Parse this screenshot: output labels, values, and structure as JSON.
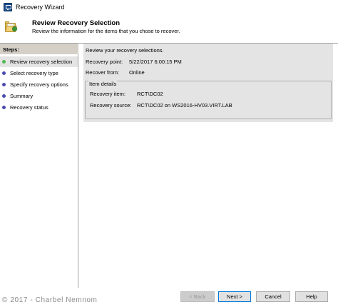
{
  "window": {
    "title": "Recovery Wizard"
  },
  "header": {
    "title": "Review Recovery Selection",
    "subtitle": "Review the information for the items that you chose to recover."
  },
  "steps": {
    "heading": "Steps:",
    "items": [
      {
        "label": "Review recovery selection",
        "active": true,
        "dot_color": "#4fb84f"
      },
      {
        "label": "Select recovery type",
        "active": false,
        "dot_color": "#4b4bb0"
      },
      {
        "label": "Specify recovery options",
        "active": false,
        "dot_color": "#4b4bb0"
      },
      {
        "label": "Summary",
        "active": false,
        "dot_color": "#4b4bb0"
      },
      {
        "label": "Recovery status",
        "active": false,
        "dot_color": "#4b4bb0"
      }
    ]
  },
  "review": {
    "heading": "Review your recovery selections.",
    "recovery_point_label": "Recovery point:",
    "recovery_point_value": "5/22/2017 6:00:15 PM",
    "recover_from_label": "Recover from:",
    "recover_from_value": "Online",
    "item_details": {
      "title": "Item details",
      "recovery_item_label": "Recovery item:",
      "recovery_item_value": "RCT\\DC02",
      "recovery_source_label": "Recovery source:",
      "recovery_source_value": "RCT\\DC02 on WS2016-HV03.VIRT.LAB"
    }
  },
  "footer": {
    "copyright": "© 2017 - Charbel Nemnom",
    "back_label": "< Back",
    "next_label": "Next >",
    "cancel_label": "Cancel",
    "help_label": "Help"
  },
  "colors": {
    "active_step": "#4fb84f",
    "inactive_step": "#4b4bb0",
    "panel_bg": "#e4e4e4",
    "primary_border": "#0078d7"
  }
}
